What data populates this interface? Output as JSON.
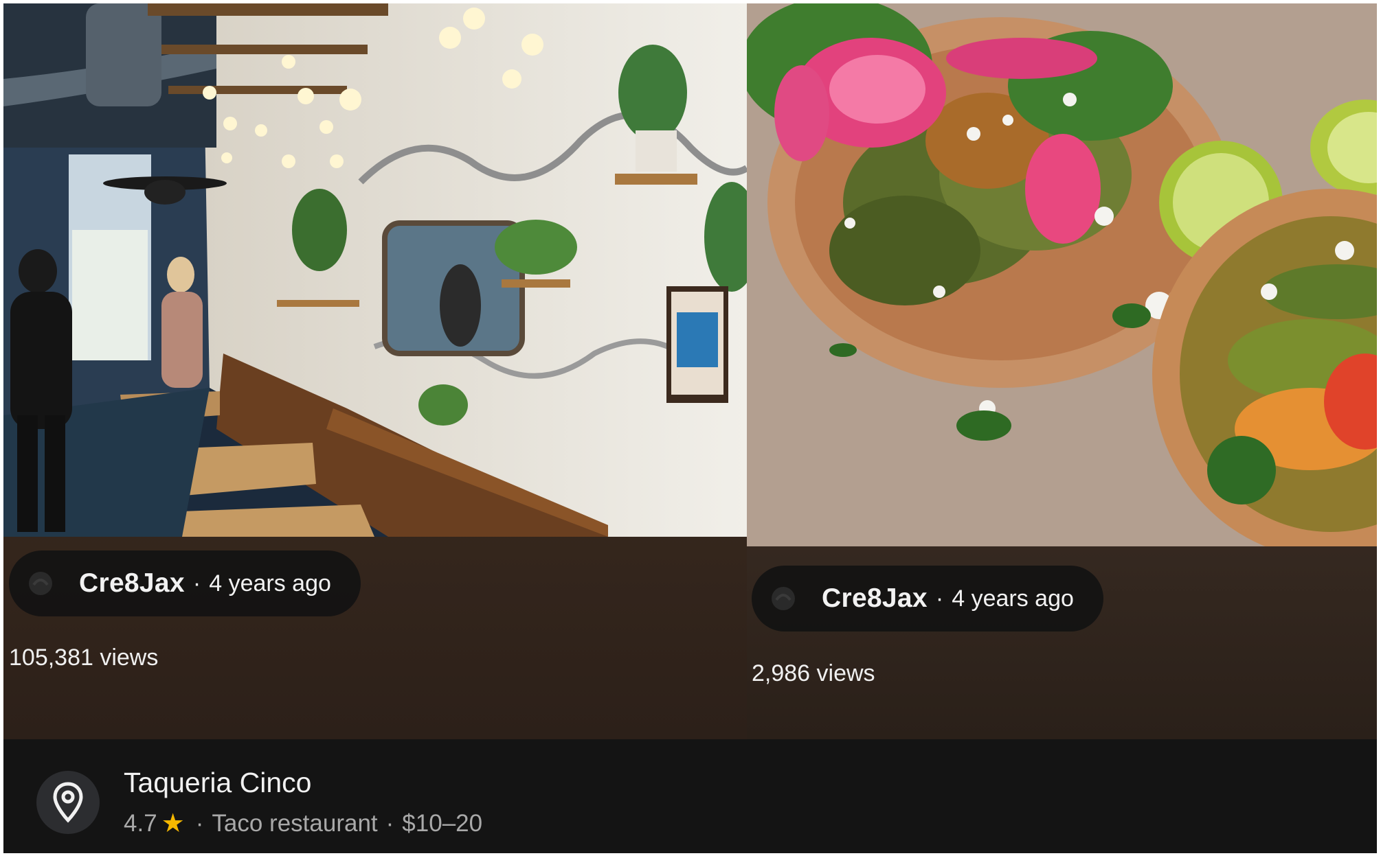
{
  "posts": [
    {
      "image": "restaurant-interior-photo",
      "author": "Cre8Jax",
      "separator": "·",
      "time": "4 years ago",
      "views": "105,381 views"
    },
    {
      "image": "tacos-photo",
      "author": "Cre8Jax",
      "separator": "·",
      "time": "4 years ago",
      "views": "2,986 views"
    }
  ],
  "place": {
    "name": "Taqueria Cinco",
    "rating": "4.7",
    "rating_icon": "star-icon",
    "separator": "·",
    "category": "Taco restaurant",
    "price": "$10–20",
    "icon": "map-pin-icon"
  },
  "colors": {
    "star": "#f6b800",
    "background": "#141414",
    "text": "#f1f1f1",
    "muted_text": "#a9a9a9"
  }
}
